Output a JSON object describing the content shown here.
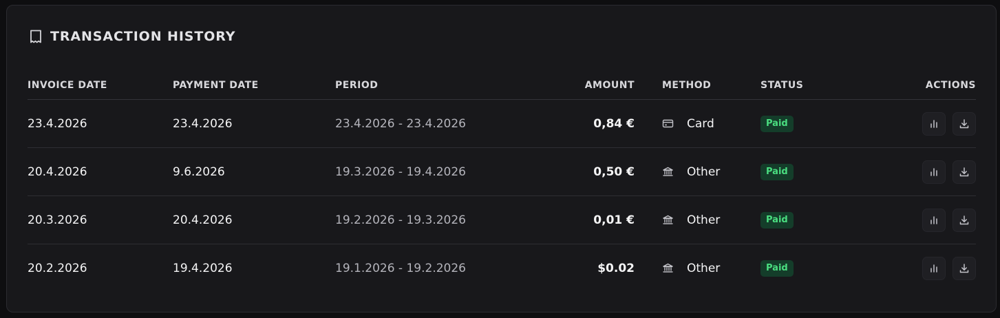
{
  "card": {
    "title": "TRANSACTION HISTORY",
    "icon": "receipt-icon"
  },
  "table": {
    "headers": {
      "invoice_date": "INVOICE DATE",
      "payment_date": "PAYMENT DATE",
      "period": "PERIOD",
      "amount": "AMOUNT",
      "method": "METHOD",
      "status": "STATUS",
      "actions": "ACTIONS"
    },
    "rows": [
      {
        "invoice_date": "23.4.2026",
        "payment_date": "23.4.2026",
        "period": "23.4.2026 - 23.4.2026",
        "amount": "0,84 €",
        "method": "Card",
        "method_icon": "credit-card-icon",
        "status": "Paid"
      },
      {
        "invoice_date": "20.4.2026",
        "payment_date": "9.6.2026",
        "period": "19.3.2026 - 19.4.2026",
        "amount": "0,50 €",
        "method": "Other",
        "method_icon": "bank-icon",
        "status": "Paid"
      },
      {
        "invoice_date": "20.3.2026",
        "payment_date": "20.4.2026",
        "period": "19.2.2026 - 19.3.2026",
        "amount": "0,01 €",
        "method": "Other",
        "method_icon": "bank-icon",
        "status": "Paid"
      },
      {
        "invoice_date": "20.2.2026",
        "payment_date": "19.4.2026",
        "period": "19.1.2026 - 19.2.2026",
        "amount": "$0.02",
        "method": "Other",
        "method_icon": "bank-icon",
        "status": "Paid"
      }
    ],
    "row_action_icons": [
      "bar-chart-icon",
      "download-icon"
    ]
  },
  "colors": {
    "page_background": "#0e0e10",
    "card_background": "#18181b",
    "status_paid_bg": "#143d2a",
    "status_paid_text": "#4ade80"
  }
}
